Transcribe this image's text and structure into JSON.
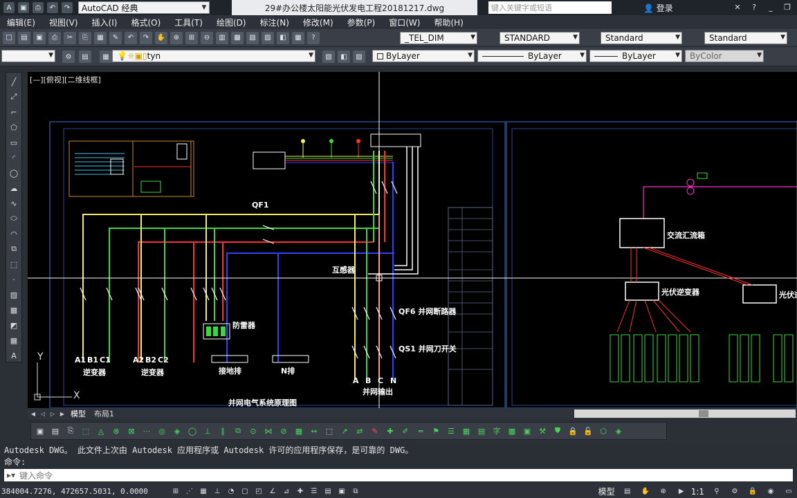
{
  "titlebar": {
    "workspace": "AutoCAD 经典",
    "document_title": "29#办公楼太阳能光伏发电工程20181217.dwg",
    "search_placeholder": "键入关键字或短语",
    "login_label": "登录"
  },
  "menu": [
    "编辑(E)",
    "视图(V)",
    "插入(I)",
    "格式(O)",
    "工具(T)",
    "绘图(D)",
    "标注(N)",
    "修改(M)",
    "参数(P)",
    "窗口(W)",
    "帮助(H)"
  ],
  "toolbar1": {
    "dimstyle": "_TEL_DIM",
    "textstyle": "STANDARD",
    "tablestyle": "Standard",
    "mleaderstyle": "Standard"
  },
  "toolbar2": {
    "layer": "tyn",
    "color": "ByLayer",
    "linetype": "ByLayer",
    "lineweight": "ByLayer",
    "plotstyle": "ByColor"
  },
  "canvas": {
    "view_label": "[—][俯视][二维线框]",
    "ucs_y": "Y",
    "ucs_x": "X",
    "drawing": {
      "qf1_label": "QF1",
      "mutual_inductor": "互感器",
      "lightning_arrester": "防雷器",
      "qf6_label": "QF6 并网断路器",
      "qs1_label": "QS1 并网刀开关",
      "phases_left_1": [
        "A1",
        "B1",
        "C1"
      ],
      "phases_left_2": [
        "A2",
        "B2",
        "C2"
      ],
      "phases_out": [
        "A",
        "B",
        "C",
        "N"
      ],
      "inverter_1": "逆变器",
      "inverter_2": "逆变器",
      "ground_bar": "接地排",
      "n_bar": "N排",
      "grid_output": "并网输出",
      "diagram_title": "并网电气系统原理图",
      "ac_combiner": "交流汇流箱",
      "pv_inverter_1": "光伏逆变器",
      "pv_inverter_2": "光伏逆变"
    }
  },
  "tabs": {
    "model": "模型",
    "layout1": "布局1"
  },
  "command_history": [
    "Autodesk DWG。  此文件上次由 Autodesk 应用程序或 Autodesk 许可的应用程序保存，是可靠的 DWG。",
    "命令:"
  ],
  "command_placeholder": "键入命令",
  "status": {
    "coords": "384004.7276, 472657.5031, 0.0000",
    "space": "模型",
    "scale": "1:1"
  },
  "colors": {
    "yellow": "#f5f05a",
    "green": "#3ed83e",
    "red": "#ff3030",
    "blue": "#3040ff",
    "white": "#ffffff",
    "frame": "#2c4a8a",
    "magenta": "#ff2fd0"
  }
}
